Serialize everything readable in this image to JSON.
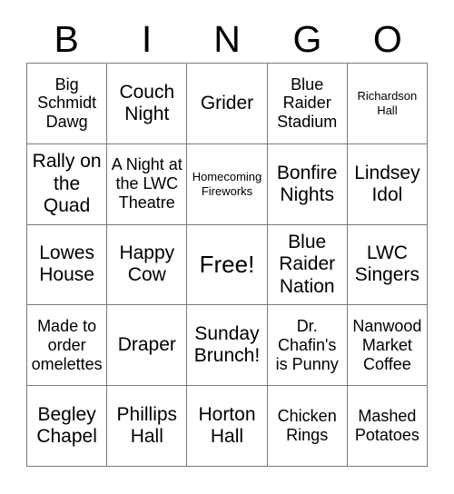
{
  "card": {
    "title": "BINGO",
    "header_letters": [
      "B",
      "I",
      "N",
      "G",
      "O"
    ],
    "free_space": {
      "row": 3,
      "column": 3,
      "label": "Free!"
    },
    "grid": {
      "rows": 5,
      "columns": 5,
      "border_color": "#7a7a7a",
      "text_color": "#000000",
      "background_color": "#ffffff"
    },
    "cells": [
      [
        {
          "text": "Big Schmidt Dawg",
          "size": "md"
        },
        {
          "text": "Couch Night",
          "size": "lg"
        },
        {
          "text": "Grider",
          "size": "lg"
        },
        {
          "text": "Blue Raider Stadium",
          "size": "md"
        },
        {
          "text": "Richardson Hall",
          "size": "sm"
        }
      ],
      [
        {
          "text": "Rally on the Quad",
          "size": "lg"
        },
        {
          "text": "A Night at the LWC Theatre",
          "size": "md"
        },
        {
          "text": "Homecoming Fireworks",
          "size": "sm"
        },
        {
          "text": "Bonfire Nights",
          "size": "lg"
        },
        {
          "text": "Lindsey Idol",
          "size": "lg"
        }
      ],
      [
        {
          "text": "Lowes House",
          "size": "lg"
        },
        {
          "text": "Happy Cow",
          "size": "lg"
        },
        {
          "text": "Free!",
          "size": "xl"
        },
        {
          "text": "Blue Raider Nation",
          "size": "lg"
        },
        {
          "text": "LWC Singers",
          "size": "lg"
        }
      ],
      [
        {
          "text": "Made to order omelettes",
          "size": "md"
        },
        {
          "text": "Draper",
          "size": "lg"
        },
        {
          "text": "Sunday Brunch!",
          "size": "lg"
        },
        {
          "text": "Dr. Chafin's is Punny",
          "size": "md"
        },
        {
          "text": "Nanwood Market Coffee",
          "size": "md"
        }
      ],
      [
        {
          "text": "Begley Chapel",
          "size": "lg"
        },
        {
          "text": "Phillips Hall",
          "size": "lg"
        },
        {
          "text": "Horton Hall",
          "size": "lg"
        },
        {
          "text": "Chicken Rings",
          "size": "md"
        },
        {
          "text": "Mashed Potatoes",
          "size": "md"
        }
      ]
    ]
  }
}
